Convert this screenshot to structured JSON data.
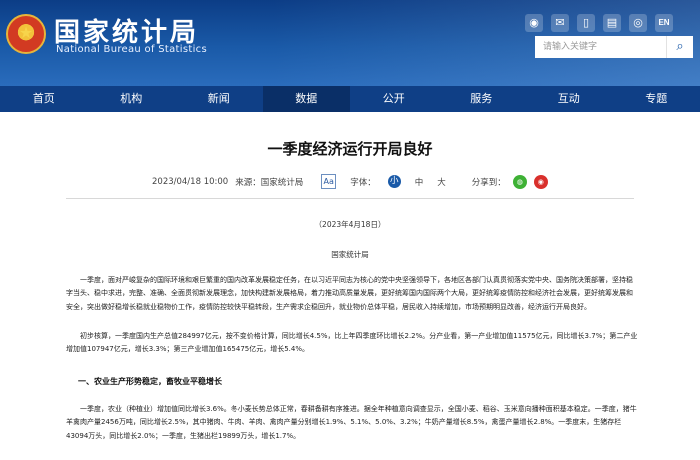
{
  "header": {
    "site_title_cn": "国家统计局",
    "site_title_en": "National Bureau of Statistics",
    "lang_en": "EN",
    "search_placeholder": "请输入关键字"
  },
  "nav": {
    "items": [
      "首页",
      "机构",
      "新闻",
      "数据",
      "公开",
      "服务",
      "互动",
      "专题"
    ],
    "active_index": 3
  },
  "article": {
    "title": "一季度经济运行开局良好",
    "datetime": "2023/04/18 10:00",
    "source": "来源：国家统计局",
    "font_button": "Aa",
    "font_label": "字体：",
    "size_small": "小",
    "size_medium": "中",
    "size_large": "大",
    "share_label": "分享到：",
    "date_line": "（2023年4月18日）",
    "bureau_line": "国家统计局",
    "paragraph1": "一季度，面对严峻复杂的国际环境和艰巨繁重的国内改革发展稳定任务，在以习近平同志为核心的党中央坚强领导下，各地区各部门认真贯彻落实党中央、国务院决策部署，坚持稳字当头、稳中求进，完整、准确、全面贯彻新发展理念，加快构建新发展格局，着力推动高质量发展，更好统筹国内国际两个大局，更好统筹疫情防控和经济社会发展，更好统筹发展和安全，突出做好稳增长稳就业稳物价工作，疫情防控较快平稳转段，生产需求企稳回升，就业物价总体平稳，居民收入持续增加，市场预期明显改善，经济运行开局良好。",
    "paragraph2": "初步核算，一季度国内生产总值284997亿元，按不变价格计算，同比增长4.5%，比上年四季度环比增长2.2%。分产业看，第一产业增加值11575亿元，同比增长3.7%；第二产业增加值107947亿元，增长3.3%；第三产业增加值165475亿元，增长5.4%。",
    "heading1": "一、农业生产形势稳定，畜牧业平稳增长",
    "paragraph3": "一季度，农业（种植业）增加值同比增长3.6%。冬小麦长势总体正常，春耕备耕有序推进。据全年种植意向调查显示，全国小麦、稻谷、玉米意向播种面积基本稳定。一季度，猪牛羊禽肉产量2456万吨，同比增长2.5%，其中猪肉、牛肉、羊肉、禽肉产量分别增长1.9%、5.1%、5.0%、3.2%；牛奶产量增长8.5%，禽蛋产量增长2.8%。一季度末，生猪存栏43094万头，同比增长2.0%；一季度，生猪出栏19899万头，增长1.7%。"
  },
  "colors": {
    "header_blue": "#1a5aa8",
    "nav_blue": "#0f3f86",
    "wechat_green": "#3eb135",
    "weibo_red": "#d9302c"
  }
}
